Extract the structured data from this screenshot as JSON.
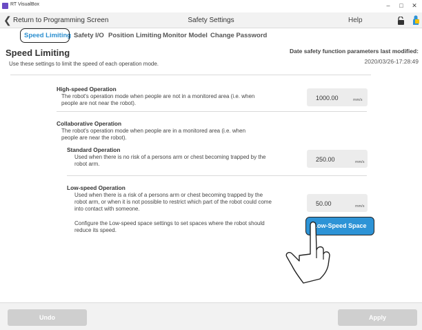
{
  "window": {
    "title": "RT VisualBox"
  },
  "header": {
    "back_label": "Return to Programming Screen",
    "title": "Safety Settings",
    "help": "Help"
  },
  "tabs": [
    {
      "label": "Speed Limiting"
    },
    {
      "label": "Safety I/O"
    },
    {
      "label": "Position Limiting"
    },
    {
      "label": "Monitor Model"
    },
    {
      "label": "Change Password"
    }
  ],
  "section": {
    "title": "Speed Limiting",
    "subtitle": "Use these settings to limit the speed of each operation mode.",
    "date_label": "Date safety function parameters last modified:",
    "date_value": "2020/03/26-17:28:49"
  },
  "high_speed": {
    "title": "High-speed Operation",
    "desc1": "The robot's operation mode when people are not in a monitored area (i.e. when",
    "desc2": "people are not near the robot).",
    "value": "1000.00",
    "unit": "mm/s"
  },
  "collaborative": {
    "title": "Collaborative Operation",
    "desc1": "The robot's operation mode when people are in a monitored area (i.e. when",
    "desc2": "people are near the robot)."
  },
  "standard": {
    "title": "Standard Operation",
    "desc1": "Used when there is no risk of a persons arm or chest becoming trapped by the",
    "desc2": "robot arm.",
    "value": "250.00",
    "unit": "mm/s"
  },
  "low_speed": {
    "title": "Low-speed Operation",
    "desc1": "Used when there is a risk of a persons arm or chest becoming trapped by the",
    "desc2": "robot arm, or when it is not possible to restrict which part of the robot could come",
    "desc3": "into contact with someone.",
    "value": "50.00",
    "unit": "mm/s",
    "config1": "Configure the Low-speed space settings to set spaces where the robot should",
    "config2": "reduce its speed.",
    "button": "Low-Speed Space"
  },
  "footer": {
    "undo": "Undo",
    "apply": "Apply"
  },
  "colors": {
    "accent": "#2d93d6",
    "tab_active": "#2b8fd0",
    "disabled_button": "#cfcfcf"
  },
  "icons": {
    "back": "chevron-left-icon",
    "lock": "unlock-icon",
    "user": "person-icon",
    "hand": "pointing-hand-icon"
  }
}
